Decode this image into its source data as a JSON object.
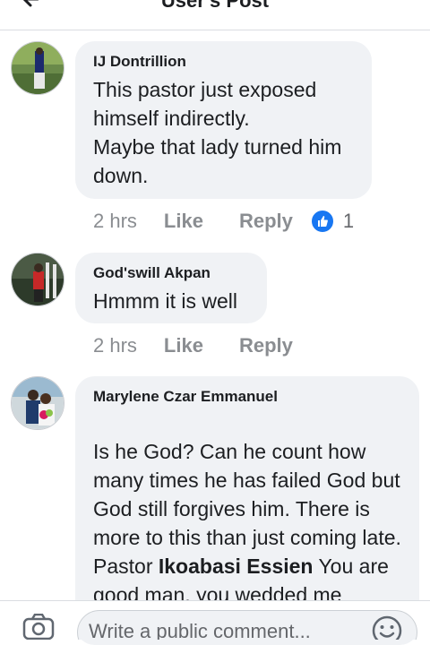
{
  "header": {
    "title": "User's Post"
  },
  "comments": [
    {
      "author": "IJ Dontrillion",
      "text": "This pastor just exposed himself indirectly.\nMaybe that lady turned him down.",
      "time": "2 hrs",
      "like_label": "Like",
      "reply_label": "Reply",
      "reaction_count": "1"
    },
    {
      "author": "God'swill Akpan",
      "text": "Hmmm it is well",
      "time": "2 hrs",
      "like_label": "Like",
      "reply_label": "Reply"
    },
    {
      "author": "Marylene Czar Emmanuel",
      "text_intro": "Is he God? Can he count how many times he has failed God but God still forgives him. There is more to this than just coming late. Pastor ",
      "mention": "Ikoabasi Essien",
      "text_after": " You are good man, you wedded me"
    }
  ],
  "composer": {
    "placeholder": "Write a public comment..."
  },
  "icons": {
    "back": "arrow-left-icon",
    "like_reaction": "thumbs-up-icon",
    "camera": "camera-icon",
    "emoji": "smiley-icon"
  },
  "colors": {
    "accent": "#1877f2",
    "bubble": "#f0f2f5",
    "meta": "#8a8d91"
  }
}
